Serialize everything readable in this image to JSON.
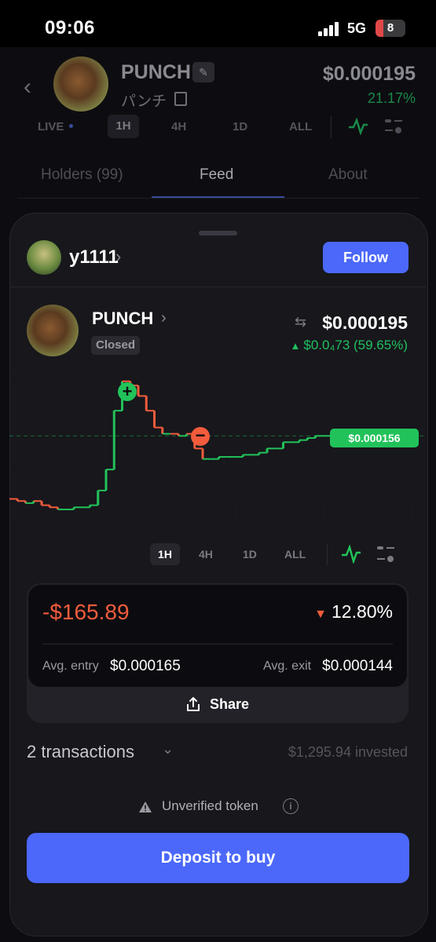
{
  "status_bar": {
    "time": "09:06",
    "network": "5G",
    "battery": "8"
  },
  "header": {
    "token_name": "PUNCH",
    "token_name_jp": "パンチ",
    "price": "$0.000195",
    "change": "21.17%",
    "timeframes": [
      "LIVE",
      "1H",
      "4H",
      "1D",
      "ALL"
    ],
    "selected_timeframe": "1H"
  },
  "tabs": [
    "Holders (99)",
    "Feed",
    "About"
  ],
  "selected_tab": "Feed",
  "user": {
    "name": "y1111",
    "follow_label": "Follow"
  },
  "token": {
    "name": "PUNCH",
    "status": "Closed",
    "price": "$0.000195",
    "change": "$0.0₄73 (59.65%)"
  },
  "chart_data": {
    "type": "line",
    "title": "",
    "current_price_label": "$0.000156",
    "markers": [
      {
        "type": "buy",
        "symbol": "+"
      },
      {
        "type": "sell",
        "symbol": "−"
      }
    ],
    "x": [
      0,
      1,
      2,
      3,
      4,
      5,
      6,
      7,
      8,
      9,
      10,
      11,
      12,
      13,
      14,
      15,
      16,
      17,
      18,
      19,
      20,
      21,
      22,
      23,
      24,
      25,
      26,
      27,
      28,
      29,
      30,
      31,
      32,
      33,
      34,
      35,
      36,
      37,
      38,
      39,
      40
    ],
    "values": [
      0.000126,
      0.000125,
      0.000124,
      0.000125,
      0.000123,
      0.000122,
      0.000121,
      0.000121,
      0.000122,
      0.000122,
      0.000123,
      0.00013,
      0.00014,
      0.000168,
      0.000182,
      0.00018,
      0.000175,
      0.000168,
      0.00016,
      0.000157,
      0.000157,
      0.000156,
      0.000157,
      0.00015,
      0.000145,
      0.000145,
      0.000146,
      0.000146,
      0.000146,
      0.000147,
      0.000147,
      0.000148,
      0.00015,
      0.00015,
      0.000153,
      0.000153,
      0.000154,
      0.000155,
      0.000156,
      0.000156,
      0.000156
    ],
    "colors": {
      "up": "#22c25a",
      "down": "#f25c3c"
    }
  },
  "chart_timeframes": [
    "1H",
    "4H",
    "1D",
    "ALL"
  ],
  "chart_selected_timeframe": "1H",
  "pnl": {
    "amount": "-$165.89",
    "percent": "12.80%",
    "avg_entry_label": "Avg. entry",
    "avg_entry": "$0.000165",
    "avg_exit_label": "Avg. exit",
    "avg_exit": "$0.000144",
    "share_label": "Share"
  },
  "transactions": {
    "label": "2 transactions",
    "invested": "$1,295.94 invested"
  },
  "warning": {
    "label": "Unverified token"
  },
  "deposit_label": "Deposit to buy",
  "colors": {
    "accent": "#4b68fa",
    "positive": "#22c25a",
    "negative": "#f25c3c",
    "background": "#000000",
    "sheet": "#17171c"
  }
}
